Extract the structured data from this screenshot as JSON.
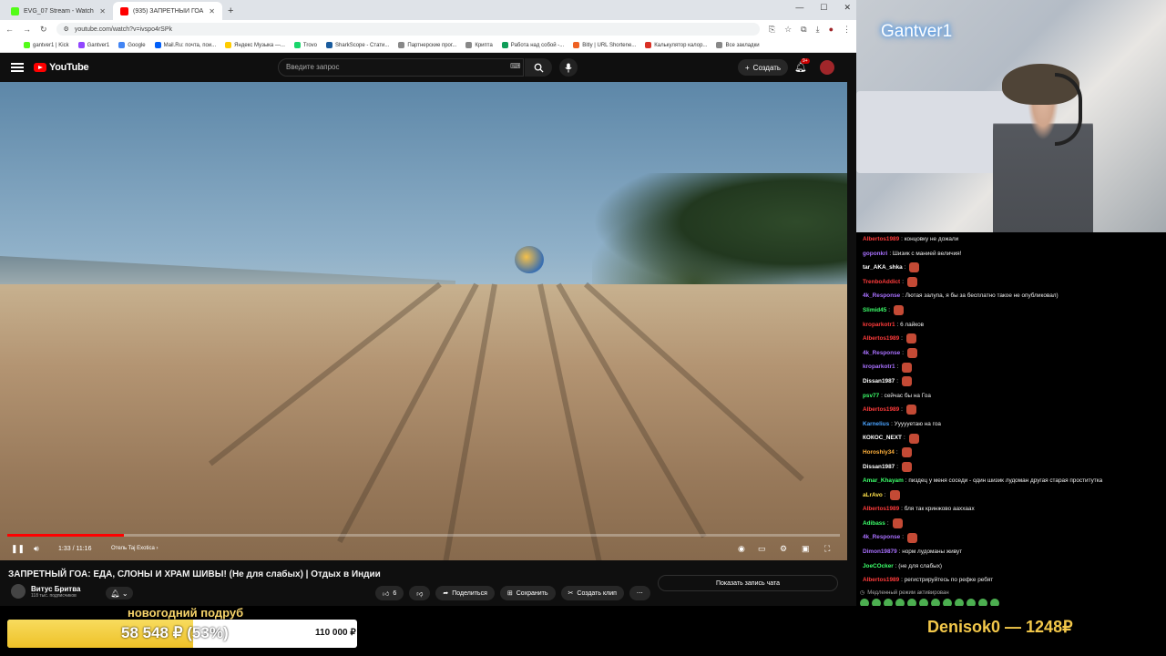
{
  "browser": {
    "tabs": [
      {
        "title": "EVG_07 Stream - Watch Live on",
        "favicon_color": "#53fc18",
        "active": false
      },
      {
        "title": "(935) ЗАПРЕТНЫЙ ГОА: ЕД",
        "favicon_color": "#ff0000",
        "active": true
      }
    ],
    "url": "youtube.com/watch?v=ivspo4rSPk",
    "bookmarks": [
      {
        "label": "gantver1 | Kick",
        "color": "#53fc18"
      },
      {
        "label": "Gantver1",
        "color": "#9146ff"
      },
      {
        "label": "Google",
        "color": "#4285f4"
      },
      {
        "label": "Mail.Ru: почта, пои...",
        "color": "#005ff9"
      },
      {
        "label": "Яндекс Музыка —...",
        "color": "#ffcc00"
      },
      {
        "label": "Trovo",
        "color": "#19d66b"
      },
      {
        "label": "SharkScope - Стати...",
        "color": "#1a5c9e"
      },
      {
        "label": "Партнерские прог...",
        "color": "#888888"
      },
      {
        "label": "Крипта",
        "color": "#888888"
      },
      {
        "label": "Работа над собой -...",
        "color": "#0f9d58"
      },
      {
        "label": "Bitly | URL Shortene...",
        "color": "#ee6123"
      },
      {
        "label": "Калькулятор калор...",
        "color": "#d93025"
      },
      {
        "label": "Все закладки",
        "color": "#888888"
      }
    ]
  },
  "youtube": {
    "logo": "YouTube",
    "search_placeholder": "Введите запрос",
    "create_label": "Создать",
    "notifications": "9+",
    "video": {
      "current_time": "1:33 / 11:16",
      "chapter": "Отель Taj Exotica ›",
      "progress": 0.14
    },
    "title": "ЗАПРЕТНЫЙ ГОА: ЕДА, СЛОНЫ И ХРАМ ШИВЫ! (Не для слабых) | Отдых в Индии",
    "channel": {
      "name": "Витус Бритва",
      "subscribers": "118 тыс. подписчиков"
    },
    "likes": "6",
    "share_label": "Поделиться",
    "save_label": "Сохранить",
    "clip_label": "Создать клип",
    "chat_replay_label": "Показать запись чата"
  },
  "stream": {
    "streamer_name": "Gantver1",
    "chat": [
      {
        "user": "Albertos1989",
        "color": "#ff3b3b",
        "text": ": концовку не дожали",
        "emote": false
      },
      {
        "user": "goponkri",
        "color": "#a970ff",
        "text": ": Шизик с манией величия!",
        "emote": false
      },
      {
        "user": "tar_AKA_shka",
        "color": "#ffffff",
        "text": ":",
        "emote": true
      },
      {
        "user": "TrenboAddict",
        "color": "#ff3b3b",
        "text": ":",
        "emote": true
      },
      {
        "user": "4k_Response",
        "color": "#a970ff",
        "text": ": Лютая залупа, я бы за бесплатно такое не опубликовал)",
        "emote": false
      },
      {
        "user": "Slimid45",
        "color": "#3cff6a",
        "text": ":",
        "emote": true
      },
      {
        "user": "kroparkotr1",
        "color": "#ff3b3b",
        "text": ": 6 лайков",
        "emote": false
      },
      {
        "user": "Albertos1989",
        "color": "#ff3b3b",
        "text": ":",
        "emote": true
      },
      {
        "user": "4k_Response",
        "color": "#a970ff",
        "text": ":",
        "emote": true
      },
      {
        "user": "kroparkotr1",
        "color": "#a970ff",
        "text": ":",
        "emote": true
      },
      {
        "user": "Dissan1987",
        "color": "#ffffff",
        "text": ":",
        "emote": true
      },
      {
        "user": "psv77",
        "color": "#3cff6a",
        "text": ": сейчас бы на Гоа",
        "emote": false
      },
      {
        "user": "Albertos1989",
        "color": "#ff3b3b",
        "text": ":",
        "emote": true
      },
      {
        "user": "Karnelius",
        "color": "#4aa3ff",
        "text": ": Уууууетаю на гоа",
        "emote": false
      },
      {
        "user": "КОКОС_NEXT",
        "color": "#ffffff",
        "text": ":",
        "emote": true
      },
      {
        "user": "Horoshiy34",
        "color": "#ffb03b",
        "text": ":",
        "emote": true
      },
      {
        "user": "Dissan1987",
        "color": "#ffffff",
        "text": ":",
        "emote": true
      },
      {
        "user": "Amar_Khayam",
        "color": "#3cff6a",
        "text": ": пиздец у меня соседи - один шизик лудоман другая старая проститутка",
        "emote": false
      },
      {
        "user": "aLrAvo",
        "color": "#ffe14a",
        "text": ":",
        "emote": true
      },
      {
        "user": "Albertos1989",
        "color": "#ff3b3b",
        "text": ": бля так кринжово ааххаах",
        "emote": false
      },
      {
        "user": "Adibass",
        "color": "#3cff6a",
        "text": ":",
        "emote": true
      },
      {
        "user": "4k_Response",
        "color": "#a970ff",
        "text": ":",
        "emote": true
      },
      {
        "user": "Dimon19879",
        "color": "#a970ff",
        "text": ": норм лудоманы живут",
        "emote": false
      },
      {
        "user": "JoeCOcker",
        "color": "#3cff6a",
        "text": ": (не для слабых)",
        "emote": false
      },
      {
        "user": "Albertos1989",
        "color": "#ff3b3b",
        "text": ": регистрируйтесь по рефке ребят",
        "emote": false
      }
    ],
    "slow_mode": "Медленный режим активирован",
    "goal": {
      "label": "новогодний подруб",
      "current": "58 548 ₽ (53%)",
      "target": "110 000 ₽",
      "fraction": 0.53
    },
    "last_donation": "Denisok0 — 1248₽"
  }
}
